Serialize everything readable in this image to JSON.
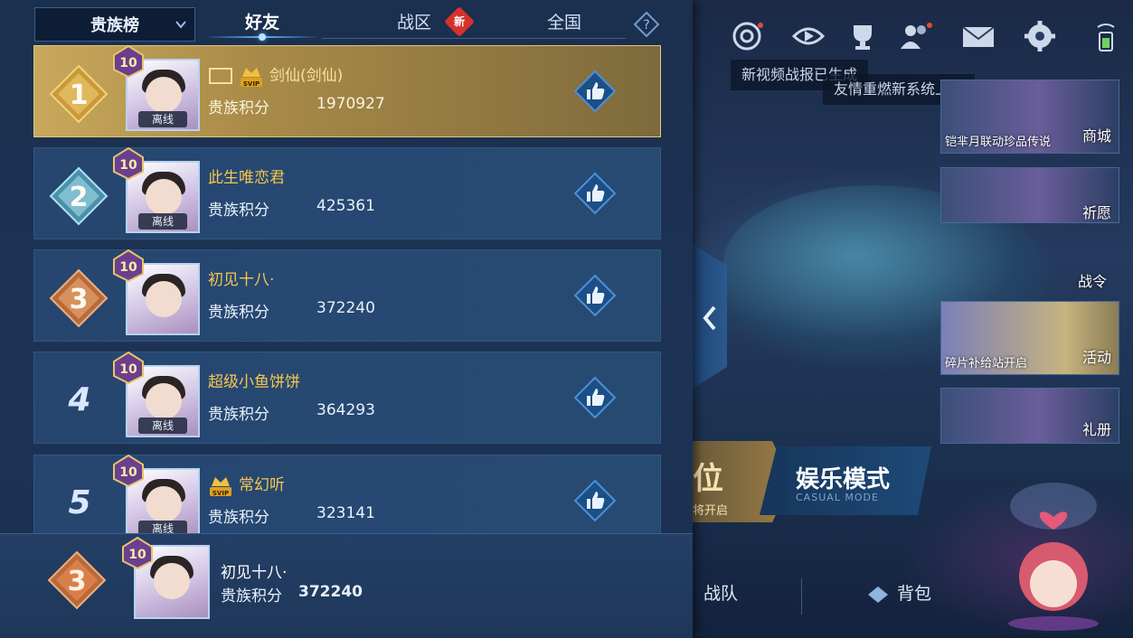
{
  "header": {
    "dropdown_label": "贵族榜",
    "tabs": [
      {
        "label": "好友",
        "active": true
      },
      {
        "label": "战区",
        "badge": "新"
      },
      {
        "label": "全国"
      }
    ],
    "help_icon": "question-icon"
  },
  "score_label": "贵族积分",
  "offline_label": "离线",
  "level": "10",
  "rows": [
    {
      "rank": "1",
      "name": "剑仙(剑仙)",
      "score": "1970927",
      "svip": true,
      "svip_text": "SVIP"
    },
    {
      "rank": "2",
      "name": "此生唯恋君",
      "score": "425361"
    },
    {
      "rank": "3",
      "name": "初见十八·",
      "score": "372240"
    },
    {
      "rank": "4",
      "name": "超级小鱼饼饼",
      "score": "364293"
    },
    {
      "rank": "5",
      "name": "常幻听",
      "score": "323141",
      "svip": true,
      "svip_text": "SVIP"
    }
  ],
  "self": {
    "rank": "3",
    "name": "初见十八·",
    "score": "372240"
  },
  "right": {
    "tips": [
      "新视频战报已生成",
      "友情重燃新系统上线"
    ],
    "side_cards": [
      {
        "caption": "铠芈月联动珍品传说",
        "label": "商城"
      },
      {
        "caption": "",
        "label": "祈愿"
      },
      {
        "caption": "碎片补给站开启",
        "label": "活动"
      },
      {
        "caption": "",
        "label": "礼册"
      }
    ],
    "battle_pass_label": "战令",
    "mode_title": "娱乐模式",
    "mode_subtitle": "CASUAL MODE",
    "rank_partial": "位",
    "rank_sub": "将开启",
    "nav": [
      "战队",
      "背包"
    ]
  },
  "colors": {
    "gold_name": "#f6c64e",
    "row_bg": "#264670",
    "first_row_bg": "#c9a85b",
    "badge_red": "#d6322b"
  }
}
